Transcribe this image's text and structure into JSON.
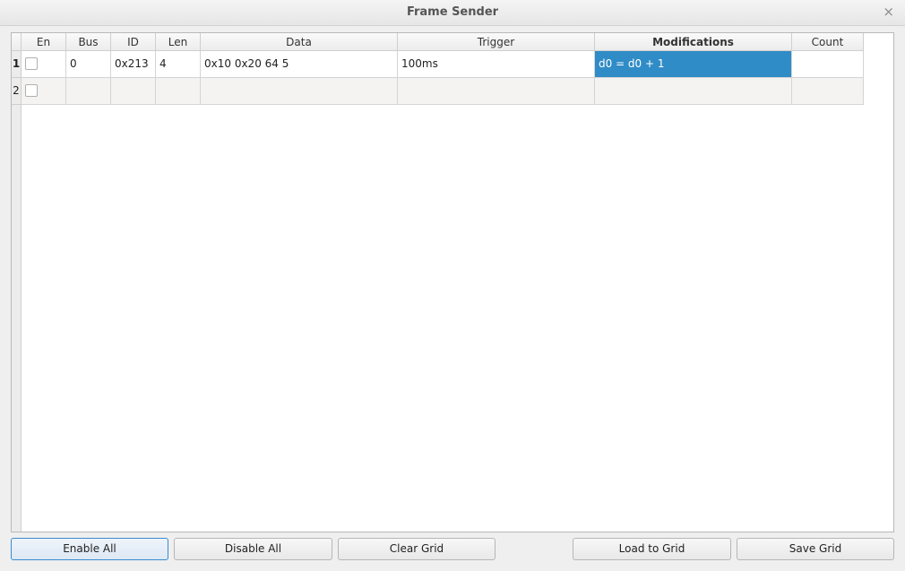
{
  "window": {
    "title": "Frame Sender",
    "close_glyph": "×"
  },
  "grid": {
    "columns": [
      "En",
      "Bus",
      "ID",
      "Len",
      "Data",
      "Trigger",
      "Modifications",
      "Count"
    ],
    "rows": [
      {
        "num": "1",
        "enabled": false,
        "bus": "0",
        "id": "0x213",
        "len": "4",
        "data": "0x10 0x20 64 5",
        "trigger": "100ms",
        "modifications": "d0 = d0 + 1",
        "count": ""
      },
      {
        "num": "2",
        "enabled": false,
        "bus": "",
        "id": "",
        "len": "",
        "data": "",
        "trigger": "",
        "modifications": "",
        "count": ""
      }
    ]
  },
  "buttons": {
    "enable_all": "Enable All",
    "disable_all": "Disable All",
    "clear_grid": "Clear Grid",
    "load_to_grid": "Load to Grid",
    "save_grid": "Save Grid"
  },
  "colors": {
    "selection": "#308cc6"
  }
}
